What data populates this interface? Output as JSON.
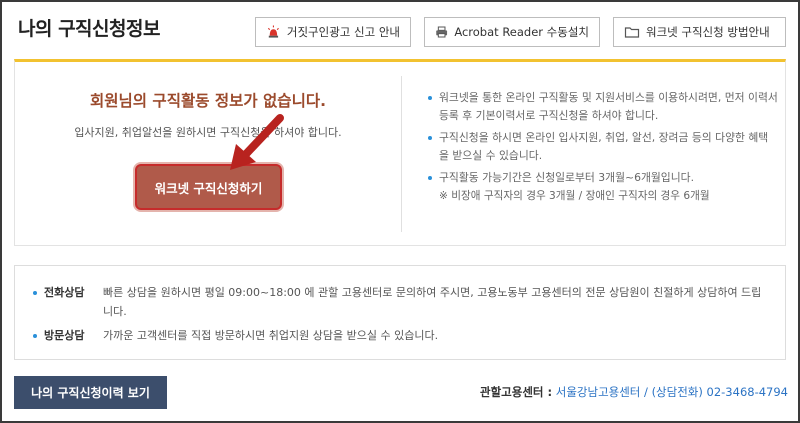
{
  "header": {
    "title": "나의 구직신청정보",
    "buttons": [
      {
        "label": "거짓구인광고 신고 안내",
        "icon": "siren-icon"
      },
      {
        "label": "Acrobat Reader 수동설치",
        "icon": "printer-icon"
      },
      {
        "label": "워크넷 구직신청 방법안내",
        "icon": "folder-icon"
      }
    ]
  },
  "status": {
    "headline": "회원님의 구직활동 정보가 없습니다.",
    "subtext": "입사지원, 취업알선을 원하시면 구직신청을 하셔야 합니다.",
    "apply_button": "워크넷 구직신청하기"
  },
  "info": {
    "bullets": [
      "워크넷을 통한 온라인 구직활동 및 지원서비스를 이용하시려면, 먼저 이력서 등록 후 기본이력서로 구직신청을 하셔야 합니다.",
      "구직신청을 하시면 온라인 입사지원, 취업, 알선, 장려금 등의 다양한 혜택을 받으실 수 있습니다.",
      "구직활동 가능기간은 신청일로부터 3개월~6개월입니다."
    ],
    "note": "※ 비장애 구직자의 경우 3개월 / 장애인 구직자의 경우 6개월"
  },
  "consult": [
    {
      "label": "전화상담",
      "text": "빠른 상담을 원하시면 평일 09:00~18:00 에 관할 고용센터로 문의하여 주시면, 고용노동부 고용센터의 전문 상담원이 친절하게 상담하여 드립니다."
    },
    {
      "label": "방문상담",
      "text": "가까운 고객센터를 직접 방문하시면 취업지원 상담을 받으실 수 있습니다."
    }
  ],
  "footer": {
    "history_button": "나의 구직신청이력 보기",
    "center_label": "관할고용센터 :",
    "center_value": "서울강남고용센터 / (상담전화) 02-3468-4794"
  },
  "colors": {
    "accent": "#f2c230",
    "headline": "#9b4a2c",
    "apply_button": "#b05a4a",
    "arrow": "#b8231f",
    "history_button": "#3c4e6c",
    "link": "#2b73c4"
  }
}
